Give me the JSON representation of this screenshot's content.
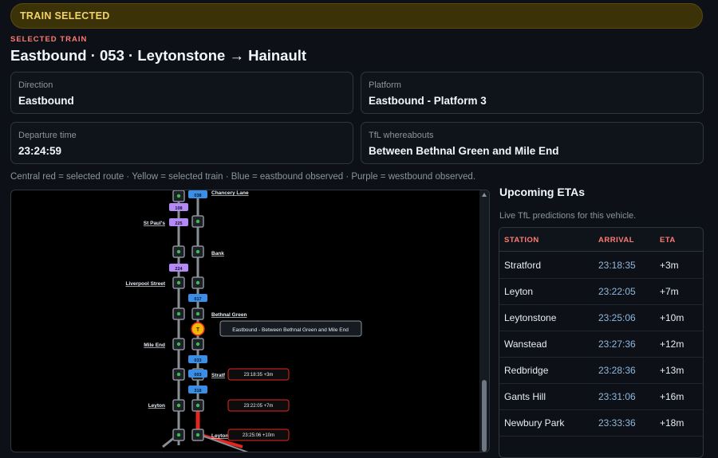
{
  "banner": {
    "label": "TRAIN SELECTED"
  },
  "header": {
    "selected_label": "SELECTED TRAIN",
    "title": "Eastbound · 053 · Leytonstone → Hainault"
  },
  "info_cards": [
    {
      "label": "Direction",
      "value": "Eastbound"
    },
    {
      "label": "Platform",
      "value": "Eastbound - Platform 3"
    },
    {
      "label": "Departure time",
      "value": "23:24:59"
    },
    {
      "label": "TfL whereabouts",
      "value": "Between Bethnal Green and Mile End"
    }
  ],
  "legend_text": "Central red = selected route · Yellow = selected train · Blue = eastbound observed · Purple = westbound observed.",
  "map": {
    "colors": {
      "route": "#e3261f",
      "selected": "#f2b705",
      "eastbound": "#3a8ee6",
      "westbound": "#b48af5"
    },
    "stations": {
      "chancery_lane": "Chancery Lane",
      "st_pauls": "St Paul's",
      "bank": "Bank",
      "liverpool_street": "Liverpool Street",
      "bethnal_green": "Bethnal Green",
      "mile_end": "Mile End",
      "stratford": "Stratf",
      "leyton": "Leyton",
      "leytonstone": "Leyton"
    },
    "trains": {
      "t038": "038",
      "t108": "108",
      "t225": "225",
      "t224": "224",
      "t017": "017",
      "t033": "033",
      "t003": "003",
      "t318": "318"
    },
    "selected_marker": "T",
    "selected_tooltip": "Eastbound - Between Bethnal Green and Mile End",
    "eta_labels": [
      "23:18:35 +3m",
      "23:22:05 +7m",
      "23:25:06 +10m"
    ]
  },
  "etas": {
    "title": "Upcoming ETAs",
    "subtitle": "Live TfL predictions for this vehicle.",
    "columns": [
      "STATION",
      "ARRIVAL",
      "ETA"
    ],
    "rows": [
      {
        "station": "Stratford",
        "arrival": "23:18:35",
        "eta": "+3m"
      },
      {
        "station": "Leyton",
        "arrival": "23:22:05",
        "eta": "+7m"
      },
      {
        "station": "Leytonstone",
        "arrival": "23:25:06",
        "eta": "+10m"
      },
      {
        "station": "Wanstead",
        "arrival": "23:27:36",
        "eta": "+12m"
      },
      {
        "station": "Redbridge",
        "arrival": "23:28:36",
        "eta": "+13m"
      },
      {
        "station": "Gants Hill",
        "arrival": "23:31:06",
        "eta": "+16m"
      },
      {
        "station": "Newbury Park",
        "arrival": "23:33:36",
        "eta": "+18m"
      }
    ]
  }
}
